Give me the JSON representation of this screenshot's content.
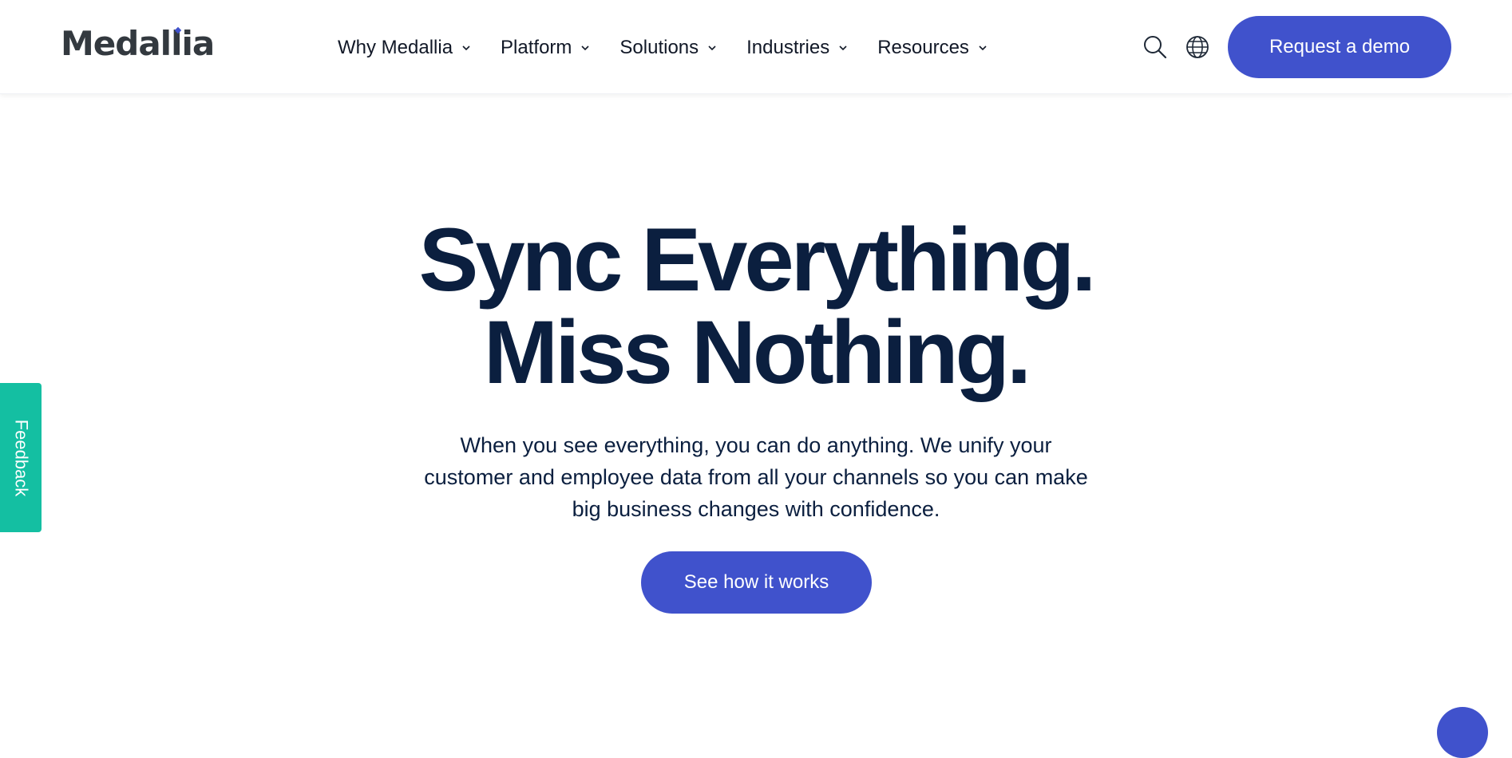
{
  "brand": {
    "logo_text": "Medallia",
    "accent_color": "#4052cc",
    "text_color": "#0b1f3f",
    "feedback_color": "#14bfa2"
  },
  "nav": {
    "items": [
      {
        "label": "Why Medallia",
        "icon": "chevron-down-icon"
      },
      {
        "label": "Platform",
        "icon": "chevron-down-icon"
      },
      {
        "label": "Solutions",
        "icon": "chevron-down-icon"
      },
      {
        "label": "Industries",
        "icon": "chevron-down-icon"
      },
      {
        "label": "Resources",
        "icon": "chevron-down-icon"
      }
    ],
    "search_icon": "search-icon",
    "language_icon": "globe-icon",
    "demo_label": "Request a demo"
  },
  "hero": {
    "title_line1": "Sync Everything.",
    "title_line2": "Miss Nothing.",
    "subtitle": "When you see everything, you can do anything. We unify your customer and employee data from all your channels so you can make big business changes with confidence.",
    "cta_label": "See how it works"
  },
  "feedback": {
    "label": "Feedback"
  },
  "chat": {
    "icon": "chat-icon"
  }
}
